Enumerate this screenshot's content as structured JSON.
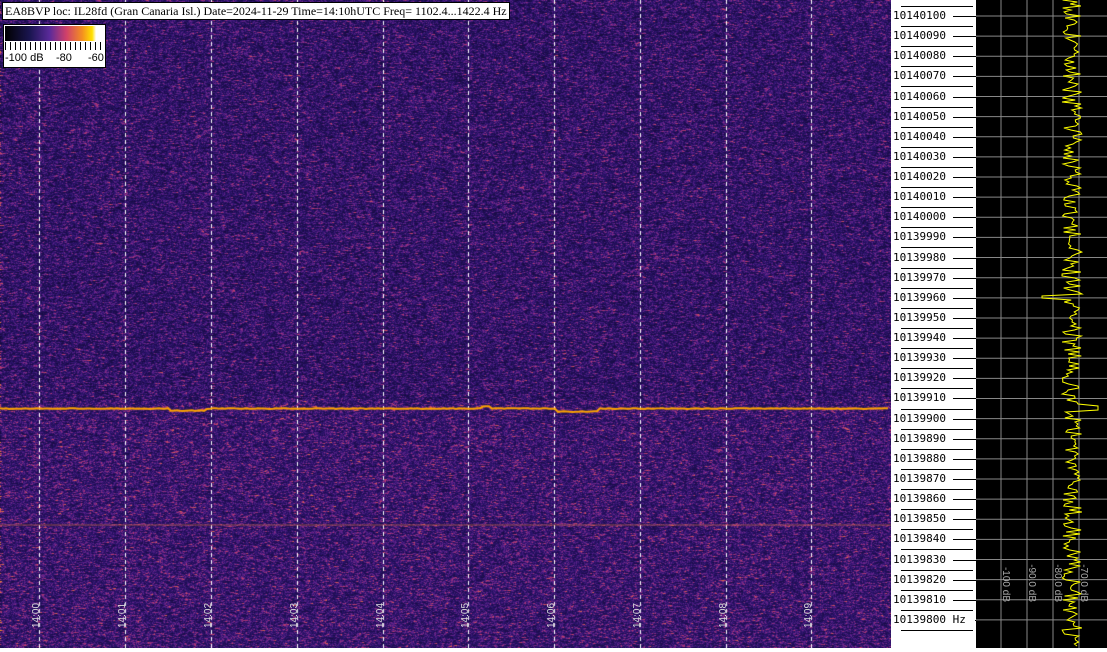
{
  "chart_data": {
    "type": "heatmap",
    "title": "EA8BVP loc: IL28fd (Gran Canaria Isl.) Date=2024-11-29 Time=14:10hUTC Freq= 1102.4...1422.4 Hz",
    "x_tick_labels": [
      "14:00",
      "14:01",
      "14:02",
      "14:03",
      "14:04",
      "14:05",
      "14:06",
      "14:07",
      "14:08",
      "14:09"
    ],
    "y_tick_labels": [
      "10140100",
      "10140090",
      "10140080",
      "10140070",
      "10140060",
      "10140050",
      "10140040",
      "10140030",
      "10140020",
      "10140010",
      "10140000",
      "10139990",
      "10139980",
      "10139970",
      "10139960",
      "10139950",
      "10139940",
      "10139930",
      "10139920",
      "10139910",
      "10139900",
      "10139890",
      "10139880",
      "10139870",
      "10139860",
      "10139850",
      "10139840",
      "10139830",
      "10139820",
      "10139810",
      "10139800 Hz"
    ],
    "ylim_hz": [
      10139800,
      10140100
    ],
    "colorbar": {
      "labels": [
        "-100 dB",
        "-80",
        "-60"
      ],
      "range_db": [
        -100,
        -60
      ],
      "colormap": "inferno"
    },
    "signal_trace_hz": 10139905,
    "power_axis_labels": [
      "-100 dB",
      "-90.0 dB",
      "-80.0 dB",
      "-70.0 dB"
    ],
    "grid": true,
    "colors": {
      "background": "#2a1260",
      "signal": "#ffa500",
      "trace": "#ffff00",
      "grid_dashes": "#ffffff"
    }
  }
}
